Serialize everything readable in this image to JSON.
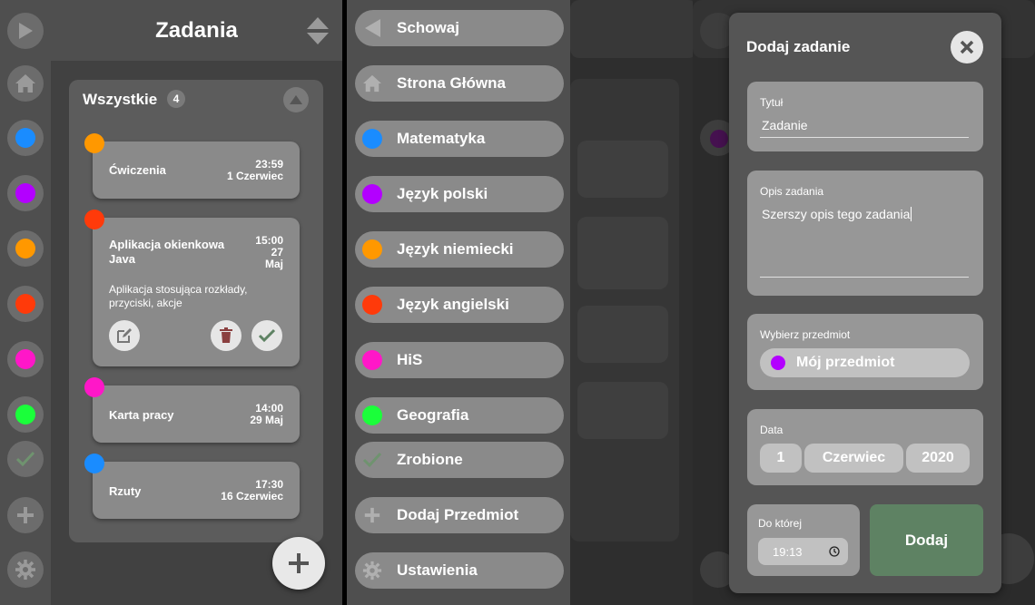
{
  "screen1": {
    "title": "Zadania",
    "section": {
      "title": "Wszystkie",
      "count": "4"
    },
    "tasks": [
      {
        "name": "Ćwiczenia",
        "time": "23:59",
        "date": "1 Czerwiec",
        "color": "#ff9800"
      },
      {
        "name": "Aplikacja okienkowa Java",
        "time": "15:00",
        "day": "27",
        "month": "Maj",
        "description": "Aplikacja stosująca rozkłady, przyciski, akcje",
        "color": "#ff3a0a"
      },
      {
        "name": "Karta pracy",
        "time": "14:00",
        "date": "29 Maj",
        "color": "#ff17c8"
      },
      {
        "name": "Rzuty",
        "time": "17:30",
        "date": "16 Czerwiec",
        "color": "#1a8cff"
      }
    ],
    "sidebar_colors": [
      "#1a8cff",
      "#b300ff",
      "#ff9800",
      "#ff3a0a",
      "#ff17c8",
      "#1aff3a"
    ]
  },
  "screen2": {
    "menu": [
      {
        "label": "Schowaj",
        "icon": "triangle-left-icon"
      },
      {
        "label": "Strona Główna",
        "icon": "home-icon"
      },
      {
        "label": "Matematyka",
        "color": "#1a8cff"
      },
      {
        "label": "Język polski",
        "color": "#b300ff"
      },
      {
        "label": "Język niemiecki",
        "color": "#ff9800"
      },
      {
        "label": "Język angielski",
        "color": "#ff3a0a"
      },
      {
        "label": "HiS",
        "color": "#ff17c8"
      },
      {
        "label": "Geografia",
        "color": "#1aff3a"
      },
      {
        "label": "Zrobione",
        "icon": "check-icon"
      },
      {
        "label": "Dodaj Przedmiot",
        "icon": "plus-icon"
      },
      {
        "label": "Ustawienia",
        "icon": "gear-icon"
      }
    ]
  },
  "screen3": {
    "modal": {
      "title": "Dodaj zadanie",
      "title_label": "Tytuł",
      "title_value": "Zadanie",
      "desc_label": "Opis zadania",
      "desc_value": "Szerszy opis tego zadania",
      "subject_label": "Wybierz przedmiot",
      "subject_value": "Mój przedmiot",
      "subject_color": "#b300ff",
      "date_label": "Data",
      "date_day": "1",
      "date_month": "Czerwiec",
      "date_year": "2020",
      "time_label": "Do której",
      "time_value": "19:13",
      "submit_label": "Dodaj",
      "submit_color": "#5e8263"
    }
  }
}
